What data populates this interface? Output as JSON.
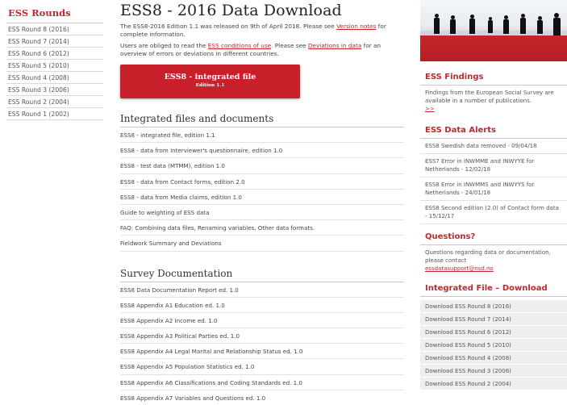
{
  "sidebar": {
    "title": "ESS Rounds",
    "items": [
      "ESS Round 8 (2016)",
      "ESS Round 7 (2014)",
      "ESS Round 6 (2012)",
      "ESS Round 5 (2010)",
      "ESS Round 4 (2008)",
      "ESS Round 3 (2006)",
      "ESS Round 2 (2004)",
      "ESS Round 1 (2002)"
    ]
  },
  "main": {
    "title": "ESS8 - 2016 Data Download",
    "intro1_before": "The ESS8-2016 Edition 1.1 was released on 9th of April 2018. Please see ",
    "intro1_link": "Version notes",
    "intro1_after": " for complete information.",
    "intro2_before": "Users are obliged to read the ",
    "intro2_link1": "ESS conditions of use",
    "intro2_mid": ". Please see ",
    "intro2_link2": "Deviations in data",
    "intro2_after": " for an overview of errors or deviations in different countries.",
    "download_button": {
      "title": "ESS8 - integrated file",
      "subtitle": "Edition 1.1"
    },
    "integrated": {
      "heading": "Integrated files and documents",
      "items": [
        "ESS8 - integrated file, edition 1.1",
        "ESS8 - data from Interviewer's questionnaire, edition 1.0",
        "ESS8 - test data (MTMM), edition 1.0",
        "ESS8 - data from Contact forms, edition 2.0",
        "ESS8 - data from Media claims, edition 1.0",
        "Guide to weighting of ESS data",
        "FAQ: Combining data files, Renaming variables, Other data formats.",
        "Fieldwork Summary and Deviations"
      ]
    },
    "survey": {
      "heading": "Survey Documentation",
      "items": [
        "ESS8 Data Documentation Report ed. 1.0",
        "ESS8 Appendix A1 Education ed. 1.0",
        "ESS8 Appendix A2 Income ed. 1.0",
        "ESS8 Appendix A3 Political Parties ed. 1.0",
        "ESS8 Appendix A4 Legal Marital and Relationship Status ed. 1.0",
        "ESS8 Appendix A5 Population Statistics ed. 1.0",
        "ESS8 Appendix A6 Classifications and Coding Standards ed. 1.0",
        "ESS8 Appendix A7 Variables and Questions ed. 1.0"
      ]
    }
  },
  "right": {
    "findings": {
      "heading": "ESS Findings",
      "text": "Findings from the European Social Survey are available in a number of publications.",
      "more": ">>"
    },
    "alerts": {
      "heading": "ESS Data Alerts",
      "items": [
        "ESS8 Swedish data removed - 09/04/18",
        "ESS7 Error in INWMME and INWYYE for Netherlands - 12/02/18",
        "ESS8 Error in INWMMS and INWYYS for Netherlands - 24/01/18",
        "ESS8 Second edition (2.0) of Contact form data - 15/12/17"
      ]
    },
    "questions": {
      "heading": "Questions?",
      "text": "Questions regarding data or documentation, please contact",
      "email": "essdatasupport@nsd.no"
    },
    "downloads": {
      "heading": "Integrated File – Download",
      "items": [
        "Download ESS Round 8 (2016)",
        "Download ESS Round 7 (2014)",
        "Download ESS Round 6 (2012)",
        "Download ESS Round 5 (2010)",
        "Download ESS Round 4 (2008)",
        "Download ESS Round 3 (2006)",
        "Download ESS Round 2 (2004)"
      ]
    }
  },
  "colors": {
    "accent": "#c0282d",
    "button": "#c8202a"
  }
}
